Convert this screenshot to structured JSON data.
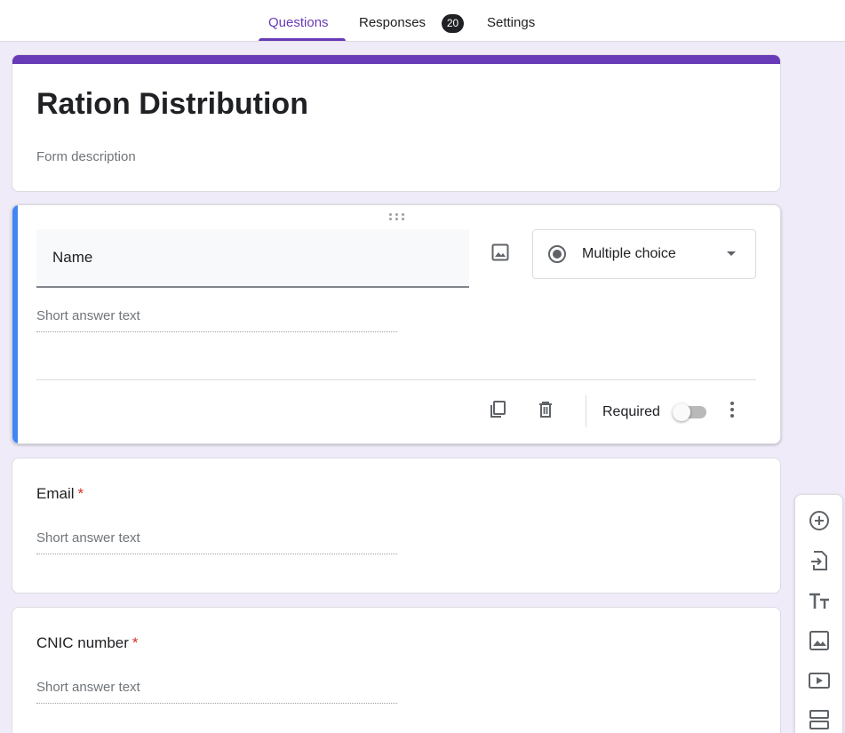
{
  "tabs": [
    {
      "label": "Questions",
      "active": true
    },
    {
      "label": "Responses",
      "badge": "20"
    },
    {
      "label": "Settings"
    }
  ],
  "form": {
    "title": "Ration Distribution",
    "description_placeholder": "Form description"
  },
  "active_question": {
    "title": "Name",
    "type": "Multiple choice",
    "answer_placeholder": "Short answer text",
    "required_label": "Required",
    "required": false
  },
  "questions": [
    {
      "title": "Email",
      "required_mark": "*",
      "answer_placeholder": "Short answer text"
    },
    {
      "title": "CNIC number",
      "required_mark": "*",
      "answer_placeholder": "Short answer text"
    }
  ],
  "icons": {
    "add_image": "image-icon",
    "type_radio": "radio-button-icon",
    "duplicate": "copy-icon",
    "delete": "trash-icon",
    "more": "more-vert-icon",
    "side_toolbar": [
      "add-circle-icon",
      "import-icon",
      "title-text-icon",
      "image-icon",
      "video-icon",
      "section-icon"
    ]
  },
  "colors": {
    "accent": "#673ab7",
    "active_bar": "#4285f4",
    "background": "#f0ebf8",
    "required": "#d93025"
  }
}
